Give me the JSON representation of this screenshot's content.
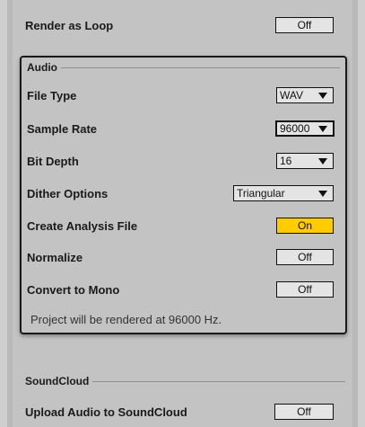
{
  "render_as_loop": {
    "label": "Render as Loop",
    "value": "Off"
  },
  "audio": {
    "title": "Audio",
    "file_type": {
      "label": "File Type",
      "value": "WAV"
    },
    "sample_rate": {
      "label": "Sample Rate",
      "value": "96000"
    },
    "bit_depth": {
      "label": "Bit Depth",
      "value": "16"
    },
    "dither": {
      "label": "Dither Options",
      "value": "Triangular"
    },
    "analysis": {
      "label": "Create Analysis File",
      "value": "On"
    },
    "normalize": {
      "label": "Normalize",
      "value": "Off"
    },
    "mono": {
      "label": "Convert to Mono",
      "value": "Off"
    },
    "note": "Project will be rendered at 96000 Hz."
  },
  "soundcloud": {
    "title": "SoundCloud",
    "upload": {
      "label": "Upload Audio to SoundCloud",
      "value": "Off"
    }
  },
  "colors": {
    "on_toggle": "#ffcc00",
    "panel": "#c3c3c3",
    "background": "#b9b9b9"
  }
}
